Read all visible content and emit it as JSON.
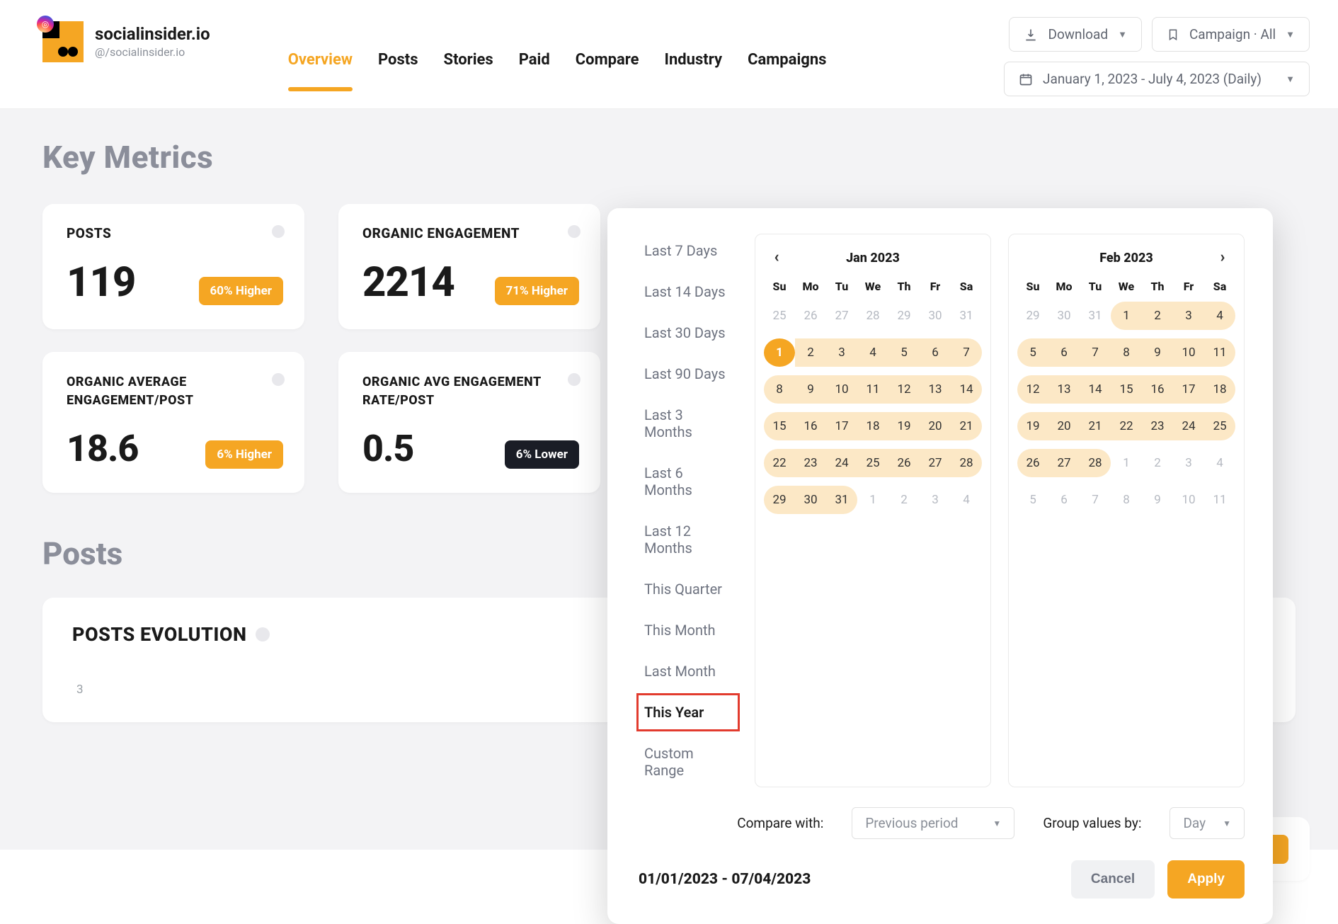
{
  "brand": {
    "name": "socialinsider.io",
    "handle": "@/socialinsider.io"
  },
  "tabs": [
    "Overview",
    "Posts",
    "Stories",
    "Paid",
    "Compare",
    "Industry",
    "Campaigns"
  ],
  "activeTab": "Overview",
  "actions": {
    "download": "Download",
    "campaign": "Campaign · All",
    "dateRange": "January 1, 2023 - July 4, 2023 (Daily)"
  },
  "sections": {
    "keyMetrics": "Key Metrics",
    "posts": "Posts",
    "postsEvolution": "POSTS EVOLUTION"
  },
  "metrics": [
    {
      "label": "POSTS",
      "value": "119",
      "delta": "60% Higher",
      "dir": "up"
    },
    {
      "label": "ORGANIC ENGAGEMENT",
      "value": "2214",
      "delta": "71% Higher",
      "dir": "up"
    },
    {
      "label": "ORGANIC AVERAGE ENGAGEMENT/POST",
      "value": "18.6",
      "delta": "6% Higher",
      "dir": "up"
    },
    {
      "label": "ORGANIC AVG ENGAGEMENT RATE/POST",
      "value": "0.5",
      "delta": "6% Lower",
      "dir": "down"
    }
  ],
  "chart_data": {
    "type": "line",
    "title": "POSTS EVOLUTION",
    "xlabel": "",
    "ylabel": "",
    "y_ticks": [
      3
    ],
    "x": [],
    "values": []
  },
  "datepicker": {
    "presets": [
      "Last 7 Days",
      "Last 14 Days",
      "Last 30 Days",
      "Last 90 Days",
      "Last 3 Months",
      "Last 6 Months",
      "Last 12 Months",
      "This Quarter",
      "This Month",
      "Last Month",
      "This Year",
      "Custom Range"
    ],
    "selectedPreset": "This Year",
    "dow": [
      "Su",
      "Mo",
      "Tu",
      "We",
      "Th",
      "Fr",
      "Sa"
    ],
    "months": [
      {
        "title": "Jan 2023",
        "navLeft": true,
        "navRight": false,
        "leading": [
          25,
          26,
          27,
          28,
          29,
          30,
          31
        ],
        "days": [
          1,
          2,
          3,
          4,
          5,
          6,
          7,
          8,
          9,
          10,
          11,
          12,
          13,
          14,
          15,
          16,
          17,
          18,
          19,
          20,
          21,
          22,
          23,
          24,
          25,
          26,
          27,
          28,
          29,
          30,
          31
        ],
        "trailing": [
          1,
          2,
          3,
          4
        ],
        "rangeFrom": 1,
        "rangeTo": 31,
        "startDay": 1
      },
      {
        "title": "Feb 2023",
        "navLeft": false,
        "navRight": true,
        "leading": [
          29,
          30,
          31
        ],
        "days": [
          1,
          2,
          3,
          4,
          5,
          6,
          7,
          8,
          9,
          10,
          11,
          12,
          13,
          14,
          15,
          16,
          17,
          18,
          19,
          20,
          21,
          22,
          23,
          24,
          25,
          26,
          27,
          28
        ],
        "trailing": [
          1,
          2,
          3,
          4,
          5,
          6,
          7,
          8,
          9,
          10,
          11
        ],
        "rangeFrom": 1,
        "rangeTo": 28
      }
    ],
    "compareLabel": "Compare with:",
    "compareValue": "Previous period",
    "groupLabel": "Group values by:",
    "groupValue": "Day",
    "rangeText": "01/01/2023 - 07/04/2023",
    "cancel": "Cancel",
    "apply": "Apply"
  }
}
